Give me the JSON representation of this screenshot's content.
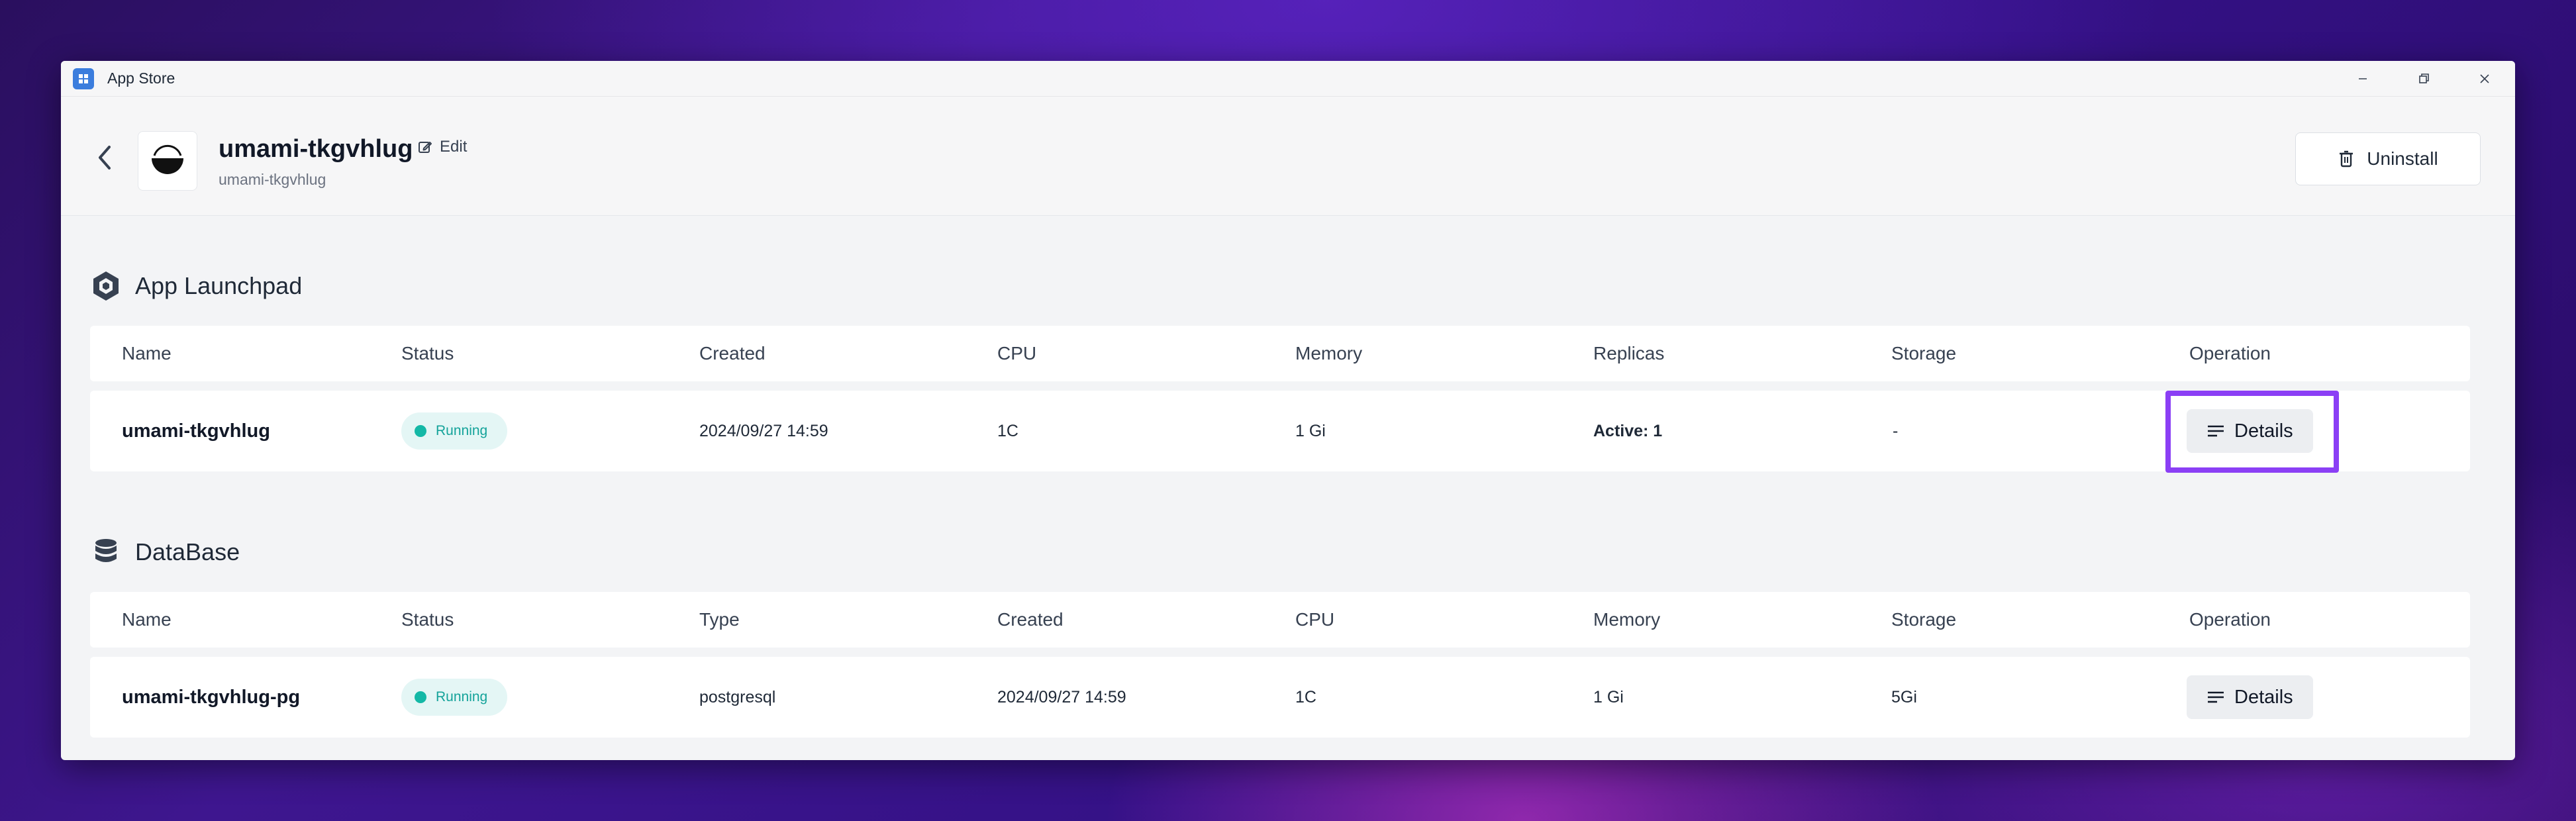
{
  "window": {
    "title": "App Store",
    "controls": [
      "minimize-icon",
      "restore-icon",
      "close-icon"
    ]
  },
  "header": {
    "app_name": "umami-tkgvhlug",
    "subtitle": "umami-tkgvhlug",
    "edit_label": "Edit",
    "uninstall_label": "Uninstall"
  },
  "launchpad": {
    "title": "App Launchpad",
    "columns": [
      "Name",
      "Status",
      "Created",
      "CPU",
      "Memory",
      "Replicas",
      "Storage",
      "Operation"
    ],
    "rows": [
      {
        "name": "umami-tkgvhlug",
        "status": "Running",
        "created": "2024/09/27 14:59",
        "cpu": "1C",
        "memory": "1 Gi",
        "replicas": "Active: 1",
        "storage": "-",
        "operation": "Details"
      }
    ]
  },
  "database": {
    "title": "DataBase",
    "columns": [
      "Name",
      "Status",
      "Type",
      "Created",
      "CPU",
      "Memory",
      "Storage",
      "Operation"
    ],
    "rows": [
      {
        "name": "umami-tkgvhlug-pg",
        "status": "Running",
        "type": "postgresql",
        "created": "2024/09/27 14:59",
        "cpu": "1C",
        "memory": "1 Gi",
        "storage": "5Gi",
        "operation": "Details"
      }
    ]
  },
  "colors": {
    "status_running": "#14b8a6",
    "highlight": "#8b3ff5",
    "app_logo": "#3b7ddd"
  }
}
